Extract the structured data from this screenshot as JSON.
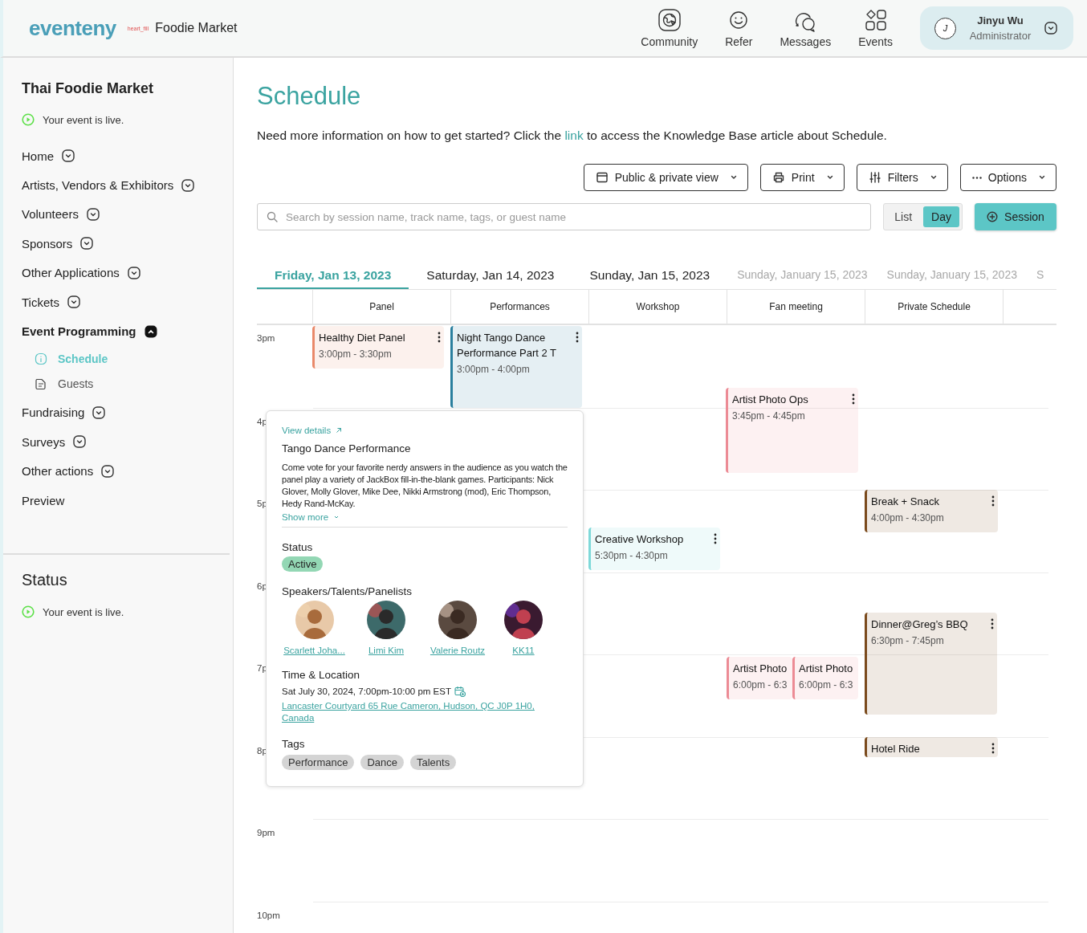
{
  "header": {
    "logo": "eventeny",
    "logo_badge": "heart_fill",
    "event_name": "Foodie Market",
    "nav": [
      {
        "label": "Community",
        "kind": "community"
      },
      {
        "label": "Refer",
        "kind": "refer"
      },
      {
        "label": "Messages",
        "kind": "messages"
      },
      {
        "label": "Events",
        "kind": "events"
      }
    ],
    "user": {
      "initial": "J",
      "name": "Jinyu Wu",
      "role": "Administrator"
    }
  },
  "sidebar": {
    "title": "Thai Foodie Market",
    "live_status": "Your event is live.",
    "items": [
      {
        "label": "Home",
        "kind": "group",
        "expanded": false
      },
      {
        "label": "Artists, Vendors & Exhibitors",
        "kind": "group",
        "expanded": false
      },
      {
        "label": "Volunteers",
        "kind": "group",
        "expanded": false
      },
      {
        "label": "Sponsors",
        "kind": "group",
        "expanded": false
      },
      {
        "label": "Other Applications",
        "kind": "group",
        "expanded": false
      },
      {
        "label": "Tickets",
        "kind": "group",
        "expanded": false
      },
      {
        "label": "Event Programming",
        "kind": "group",
        "expanded": true,
        "children": [
          {
            "label": "Schedule",
            "kind": "info",
            "selected": true
          },
          {
            "label": "Guests",
            "kind": "doc",
            "selected": false
          }
        ]
      },
      {
        "label": "Fundraising",
        "kind": "group",
        "expanded": false
      },
      {
        "label": "Surveys",
        "kind": "group",
        "expanded": false
      },
      {
        "label": "Other actions",
        "kind": "group",
        "expanded": false
      },
      {
        "label": "Preview",
        "kind": "plain"
      }
    ],
    "status": {
      "title": "Status",
      "live_status": "Your event is live."
    }
  },
  "page": {
    "title": "Schedule",
    "intro_before": "Need more information on how to get started? Click the",
    "intro_link": "link",
    "intro_after": "to access the Knowledge Base article about Schedule."
  },
  "toolbar": [
    {
      "label": "Public & private view",
      "kind": "view"
    },
    {
      "label": "Print",
      "kind": "print"
    },
    {
      "label": "Filters",
      "kind": "filters"
    },
    {
      "label": "Options",
      "kind": "options"
    }
  ],
  "search": {
    "placeholder": "Search by session name, track name, tags, or guest name"
  },
  "view_toggle": [
    {
      "label": "List",
      "selected": false
    },
    {
      "label": "Day",
      "selected": true
    }
  ],
  "add_button": "Session",
  "day_tabs": [
    {
      "label": "Friday, Jan 13, 2023",
      "selected": true,
      "faded": false
    },
    {
      "label": "Saturday, Jan 14, 2023",
      "selected": false,
      "faded": false
    },
    {
      "label": "Sunday, Jan 15, 2023",
      "selected": false,
      "faded": false
    },
    {
      "label": "Sunday, January 15, 2023",
      "selected": false,
      "faded": true
    },
    {
      "label": "Sunday, January 15, 2023",
      "selected": false,
      "faded": true
    },
    {
      "label": "S",
      "selected": false,
      "faded": true
    }
  ],
  "schedule": {
    "columns": [
      "Panel",
      "Performances",
      "Workshop",
      "Fan meeting",
      "Private Schedule"
    ],
    "hours": [
      "3pm",
      "4p",
      "5p",
      "6p",
      "7p",
      "8p",
      "9pm",
      "10pm"
    ],
    "events": [
      {
        "title": "Healthy Diet Panel",
        "time": "3:00pm - 3:30pm",
        "color": "#e9896a",
        "menu": true
      },
      {
        "title": "Night Tango Dance Performance Part 2 T",
        "time": "3:00pm - 4:00pm",
        "color": "#2a7f9e",
        "menu": true
      },
      {
        "title": "Artist Photo Ops",
        "time": "3:45pm - 4:45pm",
        "color": "#ec8b95",
        "menu": true
      },
      {
        "title": "Break + Snack",
        "time": "4:00pm - 4:30pm",
        "color": "#7a4a1c",
        "menu": true
      },
      {
        "title": "Creative Workshop",
        "time": "5:30pm - 4:30pm",
        "color": "#7fd9d9",
        "menu": true
      },
      {
        "title": "Dinner@Greg’s BBQ",
        "time": "6:30pm - 7:45pm",
        "color": "#7a4a1c",
        "menu": true
      },
      {
        "title": "Artist Photo",
        "time": "6:00pm - 6:3",
        "color": "#ec8b95",
        "menu": false
      },
      {
        "title": "Artist Photo",
        "time": "6:00pm - 6:3",
        "color": "#ec8b95",
        "menu": false
      },
      {
        "title": "Hotel Ride",
        "color": "#7a4a1c",
        "menu": true
      }
    ]
  },
  "popover": {
    "view_details": "View details",
    "title": "Tango Dance Performance",
    "description": "Come vote for your favorite nerdy answers in the audience as you watch the panel play a variety of JackBox fill-in-the-blank games. Participants: Nick Glover, Molly Glover, Mike Dee, Nikki Armstrong (mod), Eric Thompson, Hedy Rand-McKay.",
    "show_more": "Show more",
    "status_heading": "Status",
    "status": "Active",
    "speakers_heading": "Speakers/Talents/Panelists",
    "speakers": [
      {
        "name": "Scarlett Joha..."
      },
      {
        "name": "Limi Kim"
      },
      {
        "name": "Valerie Routz"
      },
      {
        "name": "KK11"
      }
    ],
    "time_heading": "Time & Location",
    "datetime": "Sat July 30, 2024, 7:00pm-10:00 pm EST",
    "location": "Lancaster Courtyard 65 Rue Cameron, Hudson, QC J0P 1H0, Canada",
    "tags_heading": "Tags",
    "tags": [
      "Performance",
      "Dance",
      "Talents"
    ]
  }
}
